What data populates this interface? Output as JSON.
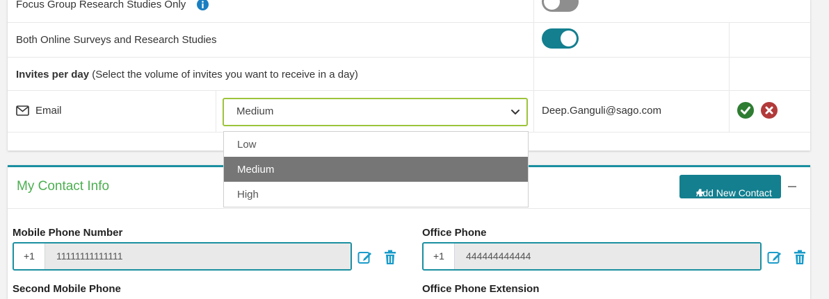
{
  "preferences": {
    "focus_label": "Focus Group Research Studies Only",
    "both_label": "Both Online Surveys and Research Studies",
    "invites_bold": "Invites per day",
    "invites_note": "(Select the volume of invites you want to receive in a day)",
    "email_label": "Email",
    "selected_volume": "Medium",
    "volume_options": [
      "Low",
      "Medium",
      "High"
    ],
    "email_address": "Deep.Ganguli@sago.com",
    "focus_toggle_on": false,
    "both_toggle_on": true
  },
  "contact": {
    "section_title": "My Contact Info",
    "add_button_label": "Add New Contact",
    "mobile_label": "Mobile Phone Number",
    "mobile_code": "+1",
    "mobile_number": "11111111111111",
    "office_label": "Office Phone",
    "office_code": "+1",
    "office_number": "444444444444",
    "second_mobile_label": "Second Mobile Phone",
    "office_ext_label": "Office Phone Extension"
  },
  "colors": {
    "teal": "#137f8f",
    "section_title_green": "#4caf50",
    "select_border": "#9cc43a",
    "check_green": "#2e7d32",
    "cancel_red": "#b23a3a"
  }
}
